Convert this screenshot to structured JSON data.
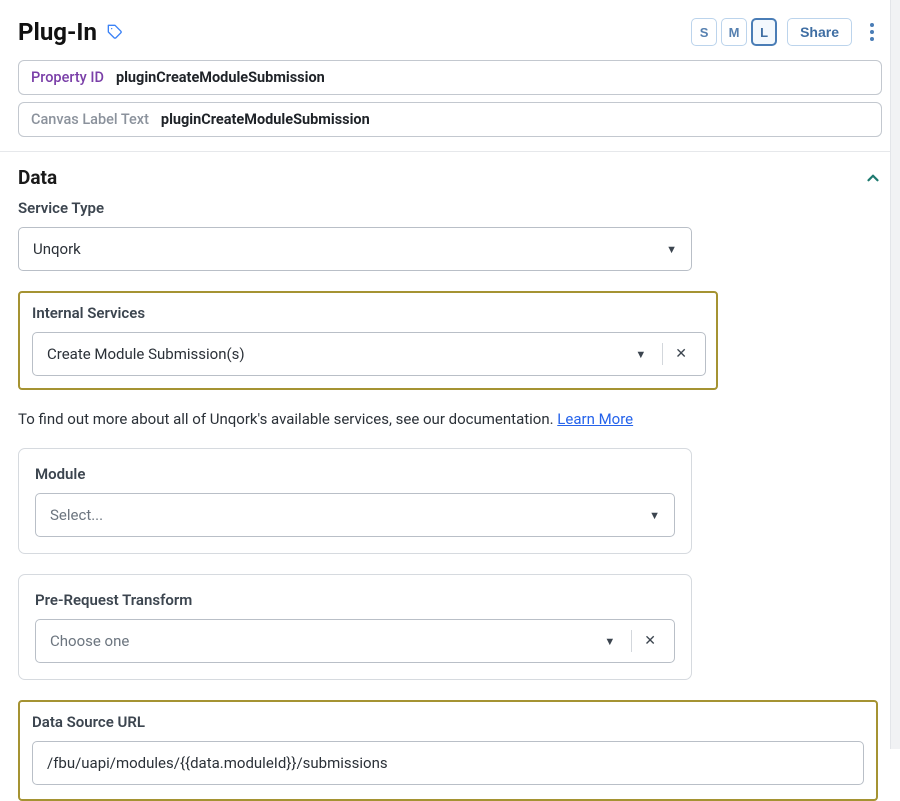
{
  "header": {
    "title": "Plug-In",
    "size_options": {
      "s": "S",
      "m": "M",
      "l": "L"
    },
    "active_size": "L",
    "share_label": "Share"
  },
  "property_row": {
    "label": "Property ID",
    "value": "pluginCreateModuleSubmission"
  },
  "canvas_row": {
    "label": "Canvas Label Text",
    "value": "pluginCreateModuleSubmission"
  },
  "section": {
    "title": "Data"
  },
  "service_type": {
    "label": "Service Type",
    "value": "Unqork"
  },
  "internal_services": {
    "label": "Internal Services",
    "value": "Create Module Submission(s)"
  },
  "info": {
    "text": "To find out more about all of Unqork's available services, see our documentation. ",
    "link_label": "Learn More"
  },
  "module": {
    "label": "Module",
    "placeholder": "Select..."
  },
  "pre_request": {
    "label": "Pre-Request Transform",
    "placeholder": "Choose one"
  },
  "data_source_url": {
    "label": "Data Source URL",
    "value": "/fbu/uapi/modules/{{data.moduleId}}/submissions"
  }
}
